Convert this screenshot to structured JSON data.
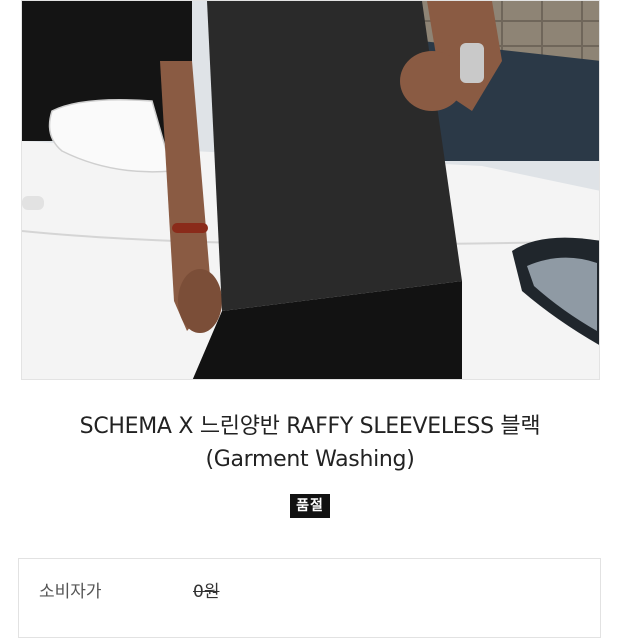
{
  "product": {
    "image_alt": "black sleeveless top photo",
    "title_line1": "SCHEMA X 느린양반 RAFFY SLEEVELESS 블랙",
    "title_line2": "(Garment Washing)",
    "status_badge": "품절"
  },
  "price": {
    "label": "소비자가",
    "value": "0원"
  }
}
